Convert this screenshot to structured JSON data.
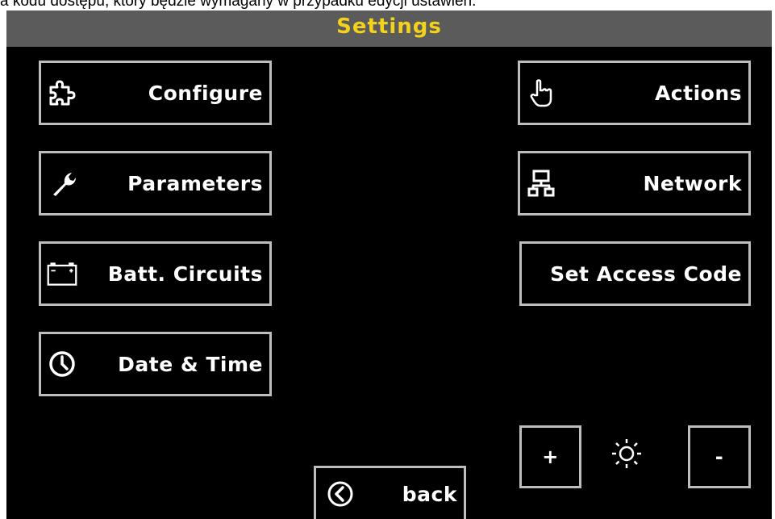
{
  "header_text": "a kodu dostępu, który będzie wymagany w przypadku edycji ustawień.",
  "window": {
    "title": "Settings"
  },
  "left_buttons": [
    {
      "label": "Configure",
      "icon": "puzzle-icon"
    },
    {
      "label": "Parameters",
      "icon": "wrench-icon"
    },
    {
      "label": "Batt. Circuits",
      "icon": "battery-icon"
    },
    {
      "label": "Date & Time",
      "icon": "clock-icon"
    }
  ],
  "right_buttons": [
    {
      "label": "Actions",
      "icon": "hand-pointer-icon"
    },
    {
      "label": "Network",
      "icon": "network-icon"
    },
    {
      "label": "Set Access Code"
    }
  ],
  "brightness": {
    "increase_label": "+",
    "decrease_label": "-",
    "icon": "sun-icon"
  },
  "back_button": {
    "label": "back",
    "icon": "back-arrow-circle-icon"
  },
  "colors": {
    "title_text": "#f3d21b",
    "titlebar_bg": "#5b5b5b",
    "screen_bg": "#000000",
    "button_border": "#bdbdbd",
    "button_text": "#ffffff"
  }
}
